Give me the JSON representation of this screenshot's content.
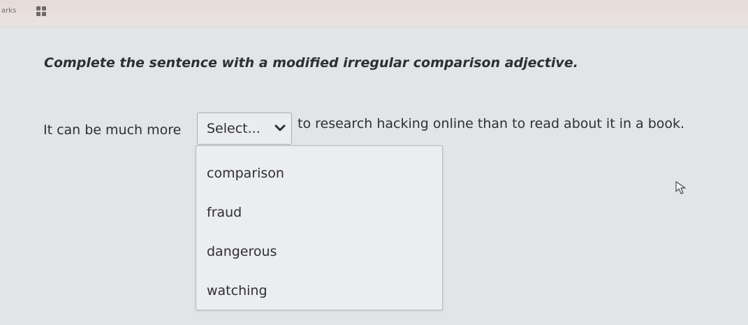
{
  "topbar": {
    "label": "arks",
    "grid_icon": "grid-icon"
  },
  "question": {
    "instruction": "Complete the sentence with a modified irregular comparison adjective.",
    "sentence_start": "It can be much more",
    "sentence_end": "to research hacking online than to read about it in a book."
  },
  "select": {
    "value": "Select...",
    "chevron_icon": "chevron-down-icon",
    "options": [
      "comparison",
      "fraud",
      "dangerous",
      "watching"
    ]
  },
  "cursor_icon": "mouse-pointer-icon"
}
